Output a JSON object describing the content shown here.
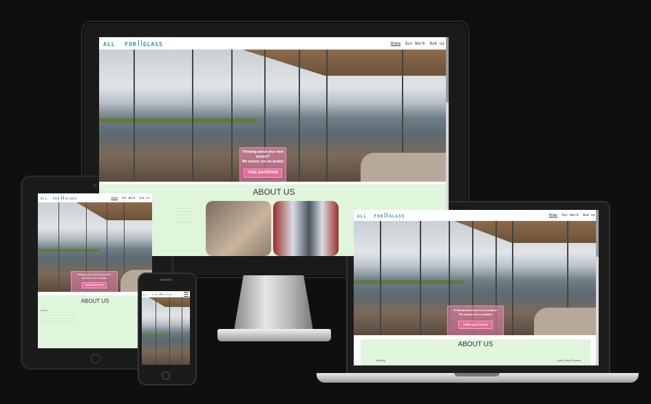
{
  "site": {
    "logo_left": "ALL",
    "logo_mid": "FOR",
    "logo_right": "GLASS",
    "nav": [
      "Home",
      "Our Work",
      "Ask us"
    ],
    "hero_line1": "Thinking about your next project?",
    "hero_line2": "We assure you on quality",
    "cta_label": "FREE QUOTATION",
    "about_title": "ABOUT US",
    "left_heading": "Starting",
    "right_heading": "Auto Glass Repairs"
  },
  "colors": {
    "background": "#0f0f0f",
    "logo": "#2a8fa0",
    "about_bg": "#dff5dc",
    "cta_pink": "#eb82af"
  }
}
